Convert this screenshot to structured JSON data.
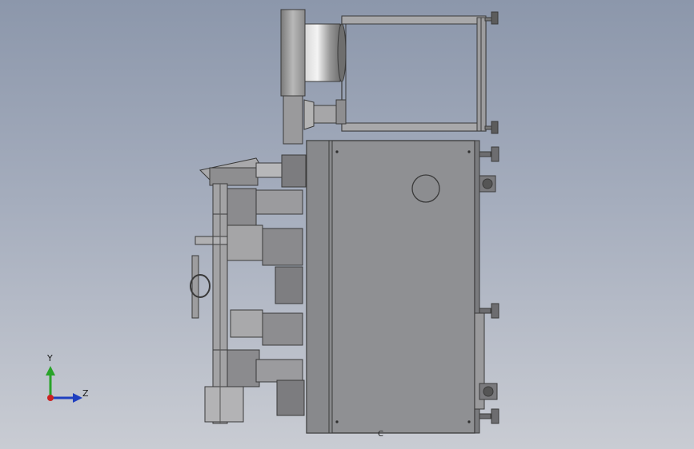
{
  "triad": {
    "y_label": "Y",
    "z_label": "Z",
    "y_color": "#29a329",
    "z_color": "#1f3fbf",
    "x_color": "#cc2222"
  },
  "view_mark": "C",
  "colors": {
    "background_top": "#8c97ab",
    "background_bottom": "#c9ccd3",
    "part_gray": "#8f9093",
    "outline": "#3a3a3a"
  }
}
